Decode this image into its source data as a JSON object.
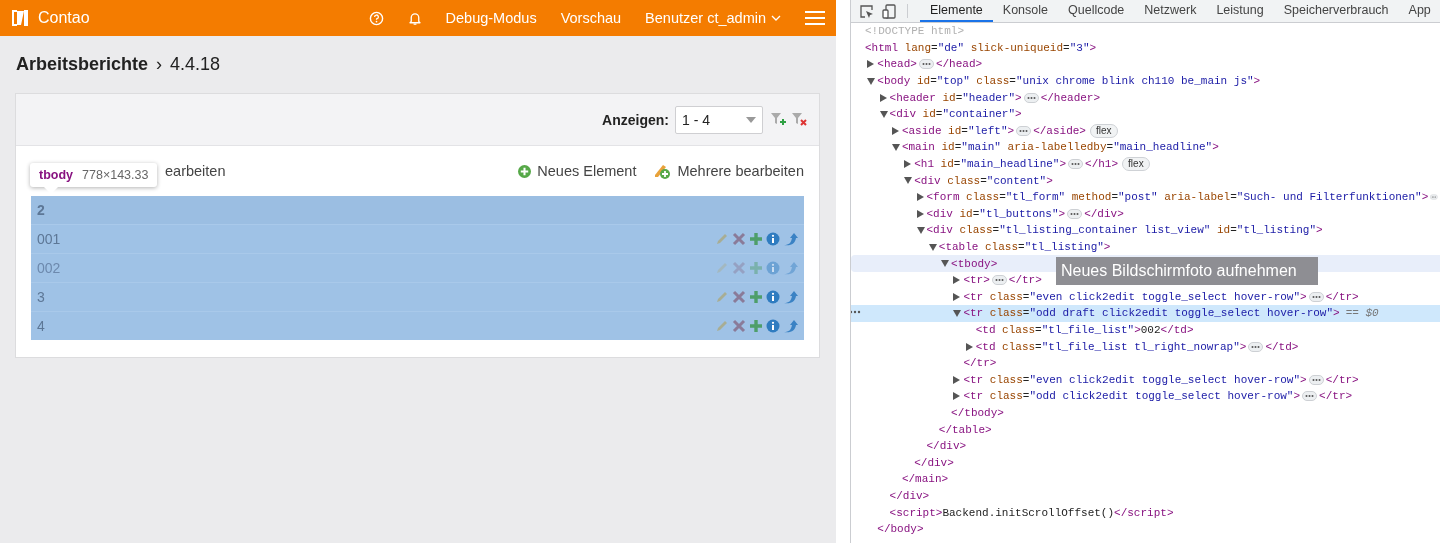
{
  "app": {
    "topbar": {
      "brand": "Contao",
      "items": [
        {
          "kind": "help"
        },
        {
          "kind": "bell"
        },
        {
          "kind": "link",
          "label": "Debug-Modus"
        },
        {
          "kind": "link",
          "label": "Vorschau"
        },
        {
          "kind": "menu",
          "label": "Benutzer ct_admin"
        },
        {
          "kind": "hamburger"
        }
      ]
    },
    "headline": {
      "title": "Arbeitsberichte",
      "separator": "›",
      "version": "4.4.18"
    },
    "filter": {
      "label": "Anzeigen:",
      "select_value": "1 - 4"
    },
    "actions": {
      "partial_link": "earbeiten",
      "buttons": [
        {
          "kind": "new",
          "label": "Neues Element"
        },
        {
          "kind": "multi",
          "label": "Mehrere bearbeiten"
        }
      ]
    },
    "rows": [
      {
        "kind": "group",
        "label": "2",
        "draft": false
      },
      {
        "kind": "item",
        "label": "001",
        "draft": false
      },
      {
        "kind": "item",
        "label": "002",
        "draft": true
      },
      {
        "kind": "item",
        "label": "3",
        "draft": false
      },
      {
        "kind": "item",
        "label": "4",
        "draft": false
      }
    ],
    "inspect_tooltip": {
      "tag": "tbody",
      "size": "778×143.33"
    }
  },
  "devtools": {
    "tabs": [
      {
        "label": "Elemente",
        "selected": true
      },
      {
        "label": "Konsole",
        "selected": false
      },
      {
        "label": "Quellcode",
        "selected": false
      },
      {
        "label": "Netzwerk",
        "selected": false
      },
      {
        "label": "Leistung",
        "selected": false
      },
      {
        "label": "Speicherverbrauch",
        "selected": false
      },
      {
        "label": "App",
        "selected": false
      }
    ],
    "tree": [
      {
        "kind": "doctype",
        "text": "<!DOCTYPE html>",
        "selected": false,
        "hovered": false
      },
      {
        "kind": "root",
        "text": "<html lang=\"de\" slick-uniqueid=\"3\">",
        "selected": false,
        "hovered": false,
        "children": [
          {
            "kind": "collapsed",
            "text": "<head>",
            "close": "</head>",
            "selected": false,
            "hovered": false
          },
          {
            "kind": "expanded",
            "text": "<body id=\"top\" class=\"unix chrome blink ch110 be_main js\">",
            "selected": false,
            "hovered": false,
            "close": "</body>",
            "children": [
              {
                "kind": "collapsed",
                "text": "<header id=\"header\">",
                "close": "</header>",
                "selected": false,
                "hovered": false
              },
              {
                "kind": "expanded",
                "text": "<div id=\"container\">",
                "selected": false,
                "hovered": false,
                "close": "</div>",
                "children": [
                  {
                    "kind": "collapsed",
                    "text": "<aside id=\"left\">",
                    "close": "</aside>",
                    "badge": "flex",
                    "selected": false,
                    "hovered": false
                  },
                  {
                    "kind": "expanded",
                    "text": "<main id=\"main\" aria-labelledby=\"main_headline\">",
                    "selected": false,
                    "hovered": false,
                    "close": "</main>",
                    "children": [
                      {
                        "kind": "collapsed",
                        "text": "<h1 id=\"main_headline\">",
                        "close": "</h1>",
                        "badge": "flex",
                        "selected": false,
                        "hovered": false
                      },
                      {
                        "kind": "expanded",
                        "text": "<div class=\"content\">",
                        "selected": false,
                        "hovered": false,
                        "close": "</div>",
                        "children": [
                          {
                            "kind": "collapsed",
                            "text": "<form class=\"tl_form\" method=\"post\" aria-label=\"Such- und Filterfunktionen\">",
                            "selected": false,
                            "hovered": false
                          },
                          {
                            "kind": "collapsed",
                            "text": "<div id=\"tl_buttons\">",
                            "close": "</div>",
                            "selected": false,
                            "hovered": false
                          },
                          {
                            "kind": "expanded",
                            "text": "<div class=\"tl_listing_container list_view\" id=\"tl_listing\">",
                            "selected": false,
                            "hovered": false,
                            "close": "</div>",
                            "children": [
                              {
                                "kind": "expanded",
                                "text": "<table class=\"tl_listing\">",
                                "selected": false,
                                "hovered": false,
                                "close": "</table>",
                                "children": [
                                  {
                                    "kind": "expanded",
                                    "text": "<tbody>",
                                    "selected": false,
                                    "hovered": true,
                                    "close": "</tbody>",
                                    "children": [
                                      {
                                        "kind": "collapsed",
                                        "text": "<tr>",
                                        "close": "</tr>",
                                        "selected": false,
                                        "hovered": false
                                      },
                                      {
                                        "kind": "collapsed",
                                        "text": "<tr class=\"even click2edit toggle_select hover-row\">",
                                        "close": "</tr>",
                                        "selected": false,
                                        "hovered": false
                                      },
                                      {
                                        "kind": "expanded",
                                        "text": "<tr class=\"odd draft click2edit toggle_select hover-row\">",
                                        "suffix": "== $0",
                                        "selected": true,
                                        "hovered": false,
                                        "close": "</tr>",
                                        "children": [
                                          {
                                            "kind": "leaf",
                                            "text": "<td class=\"tl_file_list\">002</td>",
                                            "selected": false,
                                            "hovered": false
                                          },
                                          {
                                            "kind": "collapsed",
                                            "text": "<td class=\"tl_file_list tl_right_nowrap\">",
                                            "close": "</td>",
                                            "selected": false,
                                            "hovered": false
                                          }
                                        ]
                                      },
                                      {
                                        "kind": "collapsed",
                                        "text": "<tr class=\"even click2edit toggle_select hover-row\">",
                                        "close": "</tr>",
                                        "selected": false,
                                        "hovered": false
                                      },
                                      {
                                        "kind": "collapsed",
                                        "text": "<tr class=\"odd click2edit toggle_select hover-row\">",
                                        "close": "</tr>",
                                        "selected": false,
                                        "hovered": false
                                      }
                                    ]
                                  }
                                ]
                              }
                            ]
                          }
                        ]
                      }
                    ]
                  }
                ]
              },
              {
                "kind": "leaf",
                "text": "<script>Backend.initScrollOffset()</script>",
                "selected": false,
                "hovered": false
              }
            ]
          }
        ]
      }
    ],
    "tooltip": "Neues Bildschirmfoto aufnehmen"
  }
}
